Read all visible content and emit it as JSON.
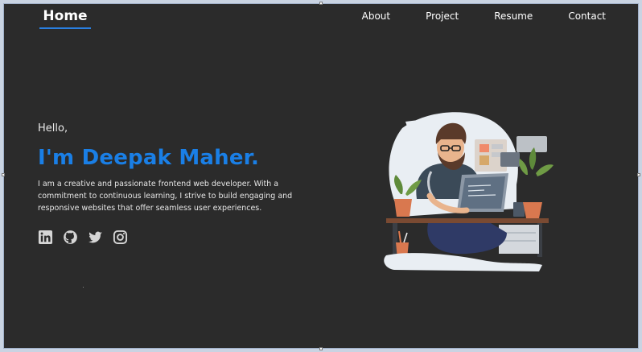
{
  "nav": {
    "brand": "Home",
    "links": [
      "About",
      "Project",
      "Resume",
      "Contact"
    ]
  },
  "hero": {
    "greeting": "Hello,",
    "name": "I'm Deepak Maher.",
    "description": "I am a creative and passionate frontend web developer. With a commitment to continuous learning, I strive to build engaging and responsive websites that offer seamless user experiences."
  },
  "socials": [
    {
      "icon": "linkedin-icon"
    },
    {
      "icon": "github-icon"
    },
    {
      "icon": "twitter-icon"
    },
    {
      "icon": "instagram-icon"
    }
  ],
  "colors": {
    "background": "#2b2b2b",
    "accent": "#1a7fe6",
    "text": "#ffffff"
  }
}
